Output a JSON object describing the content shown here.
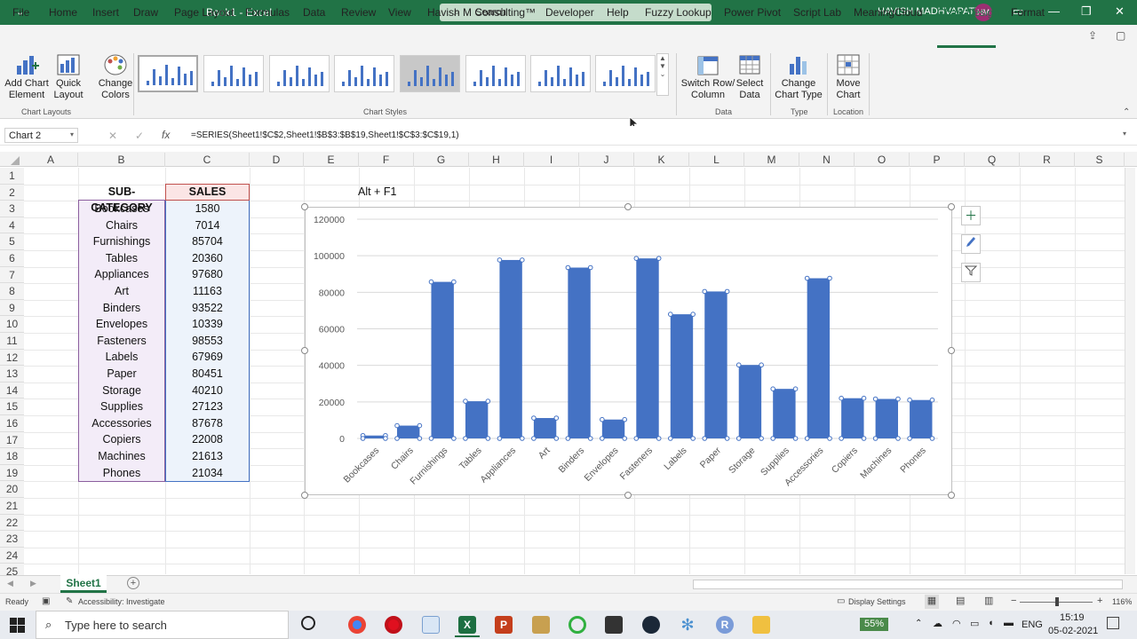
{
  "window": {
    "title": "Book1  -  Excel",
    "search_placeholder": "Search",
    "user_name": "HAVISH MADHVAPATY",
    "user_initials": "HM"
  },
  "menu": [
    "File",
    "Home",
    "Insert",
    "Draw",
    "Page Layout",
    "Formulas",
    "Data",
    "Review",
    "View",
    "Havish M Consulting™",
    "Developer",
    "Help",
    "Fuzzy Lookup",
    "Power Pivot",
    "Script Lab",
    "MeaningCloud",
    "Chart Design",
    "Format"
  ],
  "ribbon": {
    "add_chart_element": "Add Chart Element",
    "quick_layout": "Quick Layout",
    "change_colors": "Change Colors",
    "switch_row_column": "Switch Row/ Column",
    "select_data": "Select Data",
    "change_chart_type": "Change Chart Type",
    "move_chart": "Move Chart",
    "groups": {
      "chart_layouts": "Chart Layouts",
      "chart_styles": "Chart Styles",
      "data": "Data",
      "type": "Type",
      "location": "Location"
    }
  },
  "formula_bar": {
    "name_box": "Chart 2",
    "fx": "fx",
    "formula": "=SERIES(Sheet1!$C$2,Sheet1!$B$3:$B$19,Sheet1!$C$3:$C$19,1)"
  },
  "grid": {
    "columns": [
      "A",
      "B",
      "C",
      "D",
      "E",
      "F",
      "G",
      "H",
      "I",
      "J",
      "K",
      "L",
      "M",
      "N",
      "O",
      "P",
      "Q",
      "R",
      "S"
    ],
    "rows": [
      "1",
      "2",
      "3",
      "4",
      "5",
      "6",
      "7",
      "8",
      "9",
      "10",
      "11",
      "12",
      "13",
      "14",
      "15",
      "16",
      "17",
      "18",
      "19",
      "20",
      "21",
      "22",
      "23",
      "24",
      "25"
    ],
    "header_b": "SUB-CATEGORY",
    "header_c": "SALES",
    "note": "Alt + F1",
    "table": [
      [
        "Bookcases",
        "1580"
      ],
      [
        "Chairs",
        "7014"
      ],
      [
        "Furnishings",
        "85704"
      ],
      [
        "Tables",
        "20360"
      ],
      [
        "Appliances",
        "97680"
      ],
      [
        "Art",
        "11163"
      ],
      [
        "Binders",
        "93522"
      ],
      [
        "Envelopes",
        "10339"
      ],
      [
        "Fasteners",
        "98553"
      ],
      [
        "Labels",
        "67969"
      ],
      [
        "Paper",
        "80451"
      ],
      [
        "Storage",
        "40210"
      ],
      [
        "Supplies",
        "27123"
      ],
      [
        "Accessories",
        "87678"
      ],
      [
        "Copiers",
        "22008"
      ],
      [
        "Machines",
        "21613"
      ],
      [
        "Phones",
        "21034"
      ]
    ]
  },
  "chart_data": {
    "type": "bar",
    "categories": [
      "Bookcases",
      "Chairs",
      "Furnishings",
      "Tables",
      "Appliances",
      "Art",
      "Binders",
      "Envelopes",
      "Fasteners",
      "Labels",
      "Paper",
      "Storage",
      "Supplies",
      "Accessories",
      "Copiers",
      "Machines",
      "Phones"
    ],
    "values": [
      1580,
      7014,
      85704,
      20360,
      97680,
      11163,
      93522,
      10339,
      98553,
      67969,
      80451,
      40210,
      27123,
      87678,
      22008,
      21613,
      21034
    ],
    "ylim": [
      0,
      120000
    ],
    "yticks": [
      "0",
      "20000",
      "40000",
      "60000",
      "80000",
      "100000",
      "120000"
    ],
    "grid": true,
    "bar_color": "#4472c4"
  },
  "sheet_tab": "Sheet1",
  "status": {
    "ready": "Ready",
    "accessibility": "Accessibility: Investigate",
    "display_settings": "Display Settings",
    "zoom": "116%"
  },
  "taskbar": {
    "search_placeholder": "Type here to search",
    "battery": "55%",
    "lang": "ENG",
    "time": "15:19",
    "date": "05-02-2021"
  }
}
